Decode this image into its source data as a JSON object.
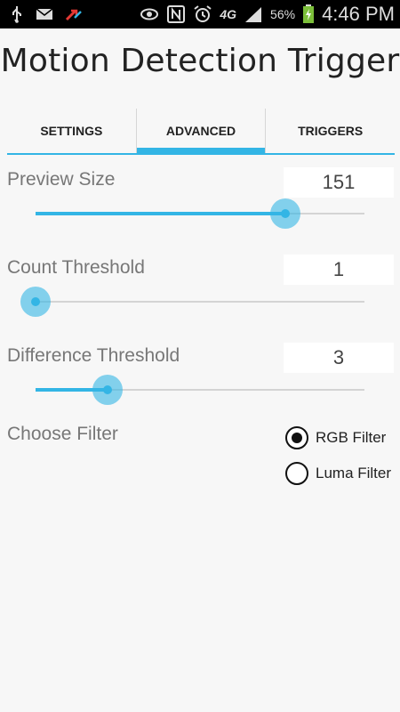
{
  "status_bar": {
    "icons_left": [
      "usb-icon",
      "email-icon",
      "missed-call-icon"
    ],
    "icons_right": [
      "eye-icon",
      "nfc-icon",
      "alarm-icon",
      "network-4g-icon",
      "signal-icon",
      "battery-charging-icon"
    ],
    "network_label": "4G",
    "battery": "56%",
    "time": "4:46 PM"
  },
  "app": {
    "title": "Motion Detection Trigger"
  },
  "tabs": [
    {
      "label": "SETTINGS",
      "selected": false
    },
    {
      "label": "ADVANCED",
      "selected": true
    },
    {
      "label": "TRIGGERS",
      "selected": false
    }
  ],
  "settings": [
    {
      "label": "Preview Size",
      "value": "151",
      "slider_fraction": 0.76
    },
    {
      "label": "Count Threshold",
      "value": "1",
      "slider_fraction": 0.0
    },
    {
      "label": "Difference Threshold",
      "value": "3",
      "slider_fraction": 0.22
    }
  ],
  "filter": {
    "label": "Choose Filter",
    "options": [
      {
        "label": "RGB Filter",
        "checked": true
      },
      {
        "label": "Luma Filter",
        "checked": false
      }
    ]
  },
  "colors": {
    "accent": "#33b5e5",
    "status_bar": "#000000",
    "background": "#f7f7f7"
  }
}
